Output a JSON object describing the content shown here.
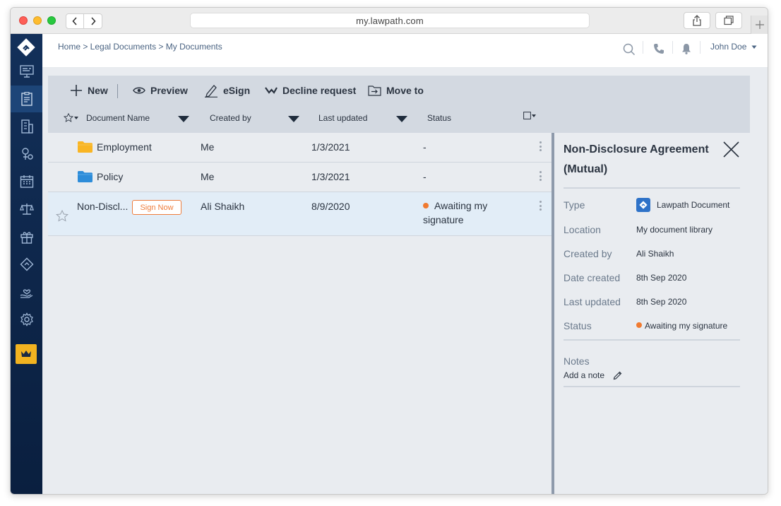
{
  "browser": {
    "url": "my.lawpath.com"
  },
  "topbar": {
    "breadcrumb": "Home > Legal Documents > My Documents",
    "user_name": "John Doe"
  },
  "sidebar": {
    "items": [
      {
        "icon": "dashboard-icon"
      },
      {
        "icon": "documents-icon",
        "active": true
      },
      {
        "icon": "company-icon"
      },
      {
        "icon": "trademark-icon"
      },
      {
        "icon": "calendar-icon"
      },
      {
        "icon": "legal-scales-icon"
      },
      {
        "icon": "gift-icon"
      },
      {
        "icon": "lawpath-icon"
      },
      {
        "icon": "care-icon"
      },
      {
        "icon": "settings-icon"
      },
      {
        "icon": "crown-icon"
      }
    ],
    "crown_color": "#f2b320"
  },
  "toolbar": {
    "new_label": "New",
    "preview_label": "Preview",
    "esign_label": "eSign",
    "decline_label": "Decline request",
    "move_label": "Move to"
  },
  "columns": {
    "name": "Document Name",
    "created_by": "Created by",
    "last_updated": "Last updated",
    "status": "Status"
  },
  "rows": [
    {
      "type": "folder",
      "folder_color": "#f9b524",
      "name": "Employment",
      "created_by": "Me",
      "last_updated": "1/3/2021",
      "status": "-"
    },
    {
      "type": "folder",
      "folder_color": "#2d8cd9",
      "name": "Policy",
      "created_by": "Me",
      "last_updated": "1/3/2021",
      "status": "-"
    },
    {
      "type": "document",
      "name": "Non-Discl...",
      "action": "Sign Now",
      "created_by": "Ali Shaikh",
      "last_updated": "8/9/2020",
      "status_line1": "Awaiting my",
      "status_line2": "signature"
    }
  ],
  "detail": {
    "title_line1": "Non-Disclosure Agreement",
    "title_line2": "(Mutual)",
    "fields": [
      {
        "label": "Type",
        "value": "Lawpath Document"
      },
      {
        "label": "Location",
        "value": "My document library"
      },
      {
        "label": "Created by",
        "value": "Ali Shaikh"
      },
      {
        "label": "Date created",
        "value": "8th Sep 2020"
      },
      {
        "label": "Last updated",
        "value": "8th Sep 2020"
      },
      {
        "label": "Status",
        "value": "Awaiting my signature"
      }
    ],
    "notes_label": "Notes",
    "add_note_label": "Add a note"
  },
  "colors": {
    "accent_orange": "#f07a30",
    "sidebar_bg": "#0d2548",
    "toolbar_bg": "#d3d9e1"
  }
}
